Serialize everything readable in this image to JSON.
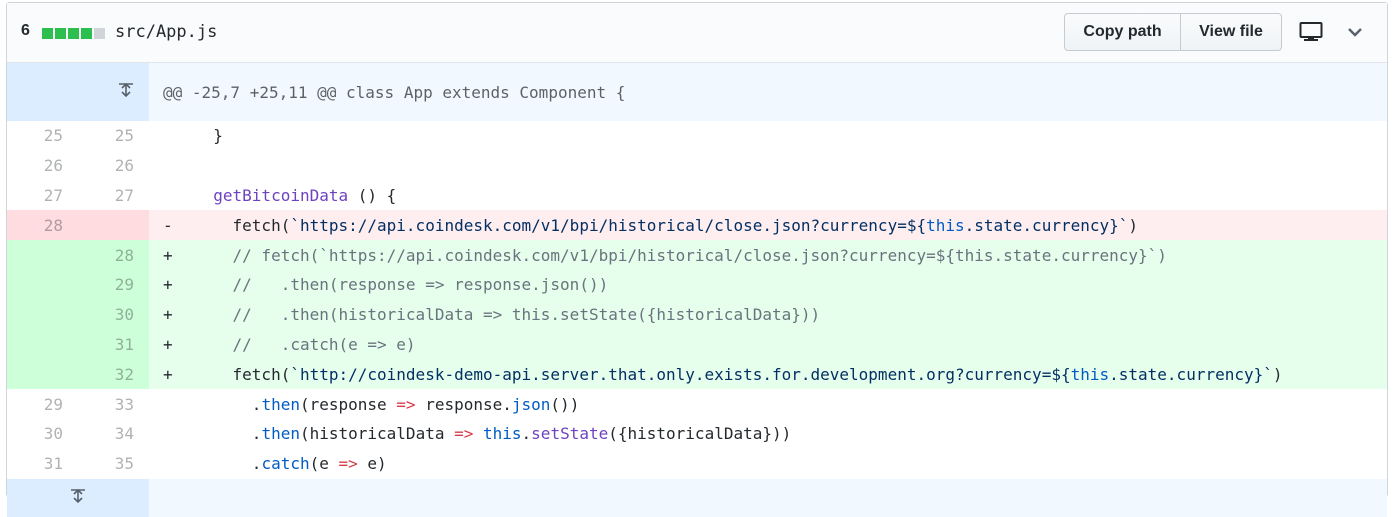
{
  "file_header": {
    "changes_count": "6",
    "diffstat_blocks": [
      "#2cbe4e",
      "#2cbe4e",
      "#2cbe4e",
      "#2cbe4e",
      "#d1d5da"
    ],
    "file_name": "src/App.js",
    "copy_path_label": "Copy path",
    "view_file_label": "View file",
    "display_icon": "desktop-icon",
    "toggle_icon": "chevron-down-icon"
  },
  "hunk_header": "@@ -25,7 +25,11 @@ class App extends Component {",
  "lines": [
    {
      "type": "context",
      "old": "25",
      "new": "25",
      "marker": " ",
      "code": "  }"
    },
    {
      "type": "context",
      "old": "26",
      "new": "26",
      "marker": " ",
      "code": ""
    },
    {
      "type": "context",
      "old": "27",
      "new": "27",
      "marker": " ",
      "code": "  getBitcoinData () {"
    },
    {
      "type": "deletion",
      "old": "28",
      "new": "",
      "marker": "-",
      "code": "    fetch(`https://api.coindesk.com/v1/bpi/historical/close.json?currency=${this.state.currency}`)"
    },
    {
      "type": "addition",
      "old": "",
      "new": "28",
      "marker": "+",
      "code": "    // fetch(`https://api.coindesk.com/v1/bpi/historical/close.json?currency=${this.state.currency}`)"
    },
    {
      "type": "addition",
      "old": "",
      "new": "29",
      "marker": "+",
      "code": "    //   .then(response => response.json())"
    },
    {
      "type": "addition",
      "old": "",
      "new": "30",
      "marker": "+",
      "code": "    //   .then(historicalData => this.setState({historicalData}))"
    },
    {
      "type": "addition",
      "old": "",
      "new": "31",
      "marker": "+",
      "code": "    //   .catch(e => e)"
    },
    {
      "type": "addition",
      "old": "",
      "new": "32",
      "marker": "+",
      "code": "    fetch(`http://coindesk-demo-api.server.that.only.exists.for.development.org?currency=${this.state.currency}`)"
    },
    {
      "type": "context",
      "old": "29",
      "new": "33",
      "marker": " ",
      "code": "      .then(response => response.json())"
    },
    {
      "type": "context",
      "old": "30",
      "new": "34",
      "marker": " ",
      "code": "      .then(historicalData => this.setState({historicalData}))"
    },
    {
      "type": "context",
      "old": "31",
      "new": "35",
      "marker": " ",
      "code": "      .catch(e => e)"
    }
  ],
  "expand_icon": "unfold-icon",
  "colors": {
    "deletion_bg": "#ffeef0",
    "deletion_num_bg": "#ffdce0",
    "addition_bg": "#e6ffed",
    "addition_num_bg": "#cdffd8",
    "hunk_bg": "#f1f8ff",
    "expand_bg": "#dbedff"
  }
}
